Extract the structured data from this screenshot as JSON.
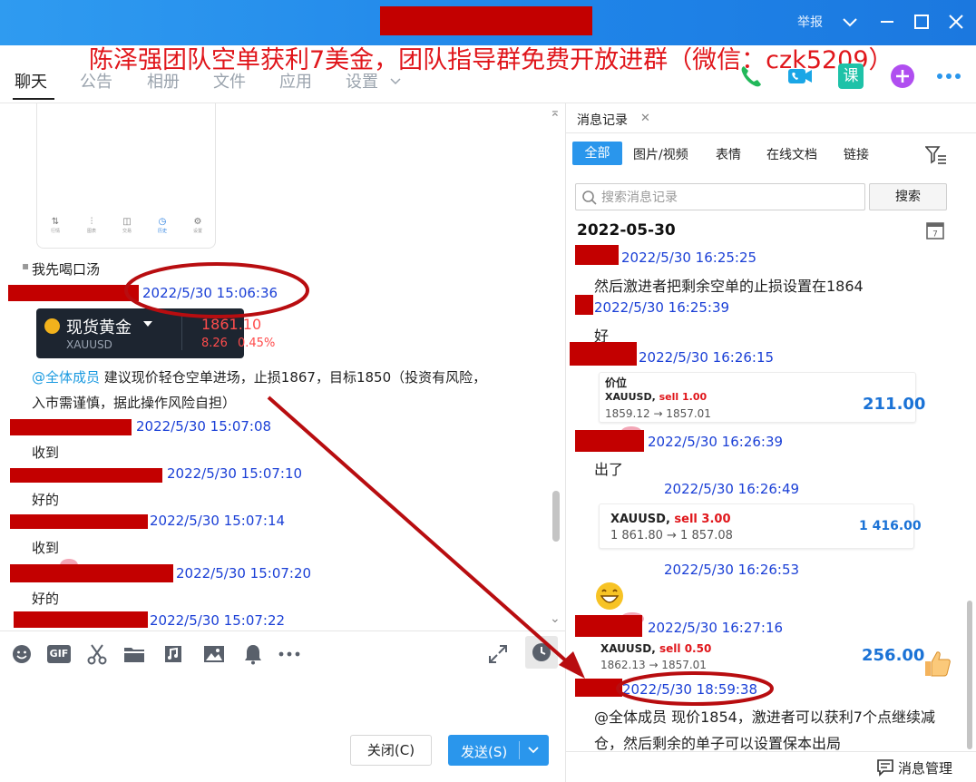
{
  "window": {
    "report_label": "举报",
    "colors": {
      "titlebar": "#2189ea",
      "redaction": "#c30000",
      "annotation": "#b80d10"
    }
  },
  "promo_text": "陈泽强团队空单获利7美金，团队指导群免费开放进群（微信：czk5209）",
  "top_tabs": [
    "聊天",
    "公告",
    "相册",
    "文件",
    "应用",
    "设置"
  ],
  "top_icons": [
    "phone-call-icon",
    "video-call-icon",
    "lesson-icon",
    "add-app-icon",
    "more-icon"
  ],
  "lesson_icon_label": "课",
  "chat": {
    "phone_nav": [
      "行情",
      "图表",
      "交易",
      "历史",
      "设置"
    ],
    "msg_drink": "我先喝口汤",
    "ts_1": "2022/5/30 15:06:36",
    "gold_card": {
      "name": "现货黄金",
      "code": "XAUUSD",
      "price": "1861.10",
      "change": "8.26",
      "percent": "0.45%"
    },
    "advice_mention": "@全体成员",
    "advice_line1": " 建议现价轻仓空单进场，止损1867，目标1850（投资有风险，",
    "advice_line2": "入市需谨慎，据此操作风险自担）",
    "replies": [
      {
        "ts": "2022/5/30 15:07:08",
        "text": "收到"
      },
      {
        "ts": "2022/5/30 15:07:10",
        "text": "好的"
      },
      {
        "ts": "2022/5/30 15:07:14",
        "text": "收到"
      },
      {
        "ts": "2022/5/30 15:07:20",
        "text": "好的"
      },
      {
        "ts": "2022/5/30 15:07:22",
        "text": ""
      }
    ]
  },
  "toolbar": {
    "tools": [
      "emoji-icon",
      "gif-icon",
      "screenshot-icon",
      "folder-icon",
      "music-icon",
      "image-icon",
      "bell-icon",
      "more-icon"
    ],
    "gif_label": "GIF",
    "close_label": "关闭(C)",
    "send_label": "发送(S)"
  },
  "history": {
    "tab_label": "消息记录",
    "filters": [
      "全部",
      "图片/视频",
      "表情",
      "在线文档",
      "链接"
    ],
    "search_placeholder": "搜索消息记录",
    "search_button": "搜索",
    "date": "2022-05-30",
    "entries": [
      {
        "ts": "2022/5/30 16:25:25",
        "text": "然后激进者把剩余空单的止损设置在1864"
      },
      {
        "ts": "2022/5/30 16:25:39",
        "text": "好"
      },
      {
        "ts": "2022/5/30 16:26:15"
      },
      {
        "ts": "2022/5/30 16:26:39",
        "text": "出了"
      },
      {
        "ts": "2022/5/30 16:26:49"
      },
      {
        "ts": "2022/5/30 16:26:53"
      },
      {
        "ts": "2022/5/30 16:27:16"
      },
      {
        "ts": "2022/5/30 18:59:38",
        "text": "@全体成员 现价1854，激进者可以获利7个点继续减",
        "text2": "仓，然后剩余的单子可以设置保本出局"
      }
    ],
    "trade_1": {
      "header": "价位",
      "symbol": "XAUUSD,",
      "side": "sell 1.00",
      "prices": "1859.12 → 1857.01",
      "profit": "211.00"
    },
    "trade_2": {
      "symbol": "XAUUSD,",
      "side": "sell 3.00",
      "prices": "1 861.80 → 1 857.08",
      "profit": "1 416.00"
    },
    "trade_3": {
      "symbol": "XAUUSD,",
      "side": "sell 0.50",
      "prices": "1862.13 → 1857.01",
      "profit": "256.00"
    },
    "manage_label": "消息管理"
  }
}
